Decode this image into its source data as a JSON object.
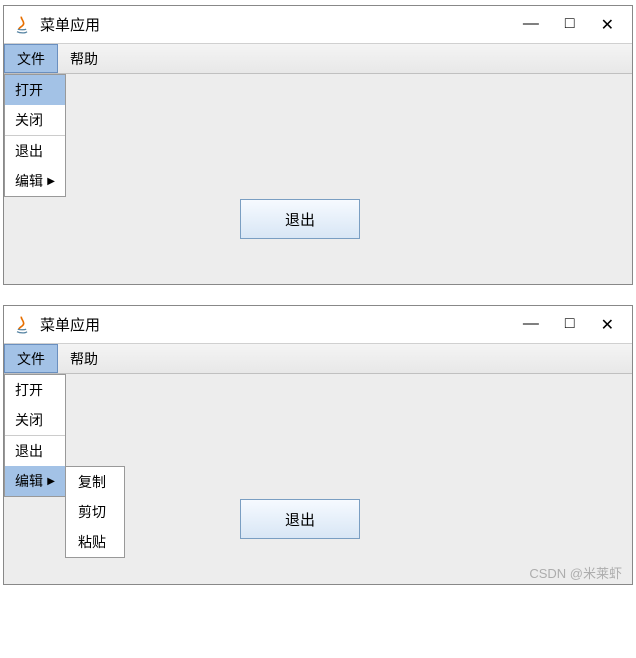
{
  "window": {
    "title": "菜单应用",
    "controls": {
      "min": "—",
      "max": "□",
      "close": "✕"
    }
  },
  "menubar": {
    "file": "文件",
    "help": "帮助"
  },
  "fileMenu": {
    "open": "打开",
    "close": "关闭",
    "exit": "退出",
    "edit": "编辑"
  },
  "editSubmenu": {
    "copy": "复制",
    "cut": "剪切",
    "paste": "粘贴"
  },
  "button": {
    "exit": "退出"
  },
  "watermark": "CSDN @米莱虾"
}
